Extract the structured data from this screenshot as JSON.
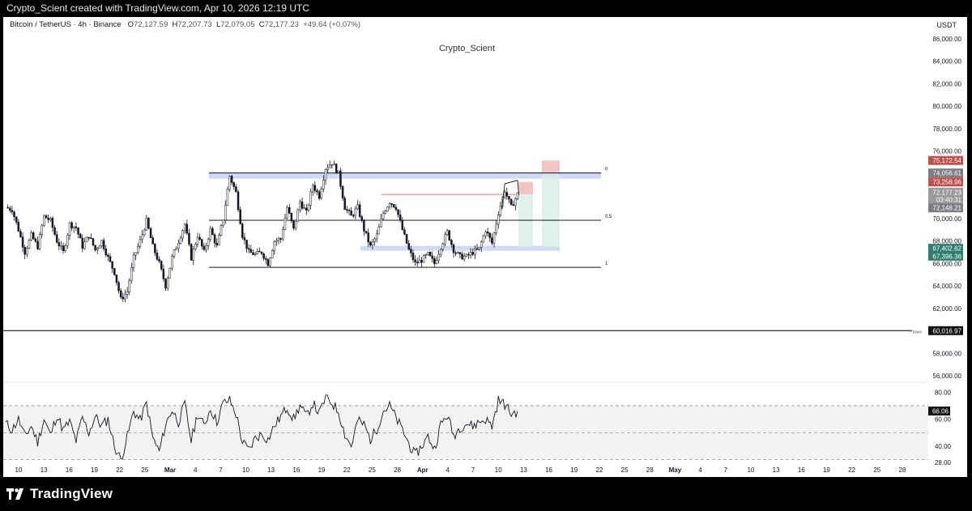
{
  "header": {
    "caption": "Crypto_Scient created with TradingView.com, Apr 10, 2026 12:19 UTC"
  },
  "legend": {
    "symbol": "Bitcoin / TetherUS · 4h · Binance",
    "o_label": "O",
    "o_value": "72,127.59",
    "h_label": "H",
    "h_value": "72,207.73",
    "l_label": "L",
    "l_value": "72,079.05",
    "c_label": "C",
    "c_value": "72,177.23",
    "change": "+49.64 (+0.07%)"
  },
  "watermark": "Crypto_Scient",
  "currency": "USDT",
  "footer": {
    "logo_text": "TradingView"
  },
  "colors": {
    "candle": "#131722",
    "range_band": "#c8d4f5",
    "red_line": "#e57373",
    "stop_zone": "#f2c4c4",
    "target_zone": "#d7ebe4",
    "rsi_band": "#f2f2f2"
  },
  "chart_data": [
    {
      "type": "candlestick",
      "symbol": "Bitcoin / TetherUS",
      "timeframe": "4h",
      "ylim": [
        57000,
        87000
      ],
      "y_ticks": [
        "86,000.00",
        "84,000.00",
        "82,000.00",
        "80,000.00",
        "78,000.00",
        "76,000.00",
        "74,000.00",
        "72,000.00",
        "70,000.00",
        "68,000.00",
        "66,000.00",
        "64,000.00",
        "62,000.00",
        "60,000.00",
        "58,000.00",
        "56,000.00"
      ],
      "x_ticks": [
        "10",
        "13",
        "16",
        "19",
        "22",
        "25",
        "Mar",
        "4",
        "7",
        "10",
        "13",
        "16",
        "19",
        "22",
        "25",
        "28",
        "Apr",
        "4",
        "7",
        "10",
        "13",
        "16",
        "19",
        "22",
        "25",
        "28",
        "May",
        "4",
        "7",
        "10",
        "13",
        "16",
        "19",
        "22",
        "25",
        "28"
      ],
      "close_path": [
        [
          0,
          71000
        ],
        [
          1,
          70800
        ],
        [
          2,
          69000
        ],
        [
          3,
          67000
        ],
        [
          4,
          68500
        ],
        [
          5,
          67500
        ],
        [
          6,
          70200
        ],
        [
          7,
          69800
        ],
        [
          8,
          68000
        ],
        [
          9,
          67000
        ],
        [
          10,
          69500
        ],
        [
          11,
          69200
        ],
        [
          12,
          67500
        ],
        [
          13,
          68500
        ],
        [
          14,
          67200
        ],
        [
          15,
          68000
        ],
        [
          16,
          66500
        ],
        [
          17,
          65200
        ],
        [
          18,
          62800
        ],
        [
          19,
          63500
        ],
        [
          20,
          66500
        ],
        [
          21,
          68000
        ],
        [
          22,
          69800
        ],
        [
          23,
          67500
        ],
        [
          24,
          66000
        ],
        [
          25,
          64000
        ],
        [
          26,
          66500
        ],
        [
          27,
          68000
        ],
        [
          28,
          69500
        ],
        [
          29,
          66500
        ],
        [
          30,
          68500
        ],
        [
          31,
          67000
        ],
        [
          32,
          69000
        ],
        [
          33,
          67500
        ],
        [
          34,
          70000
        ],
        [
          35,
          73800
        ],
        [
          36,
          72300
        ],
        [
          37,
          68500
        ],
        [
          38,
          67000
        ],
        [
          39,
          66800
        ],
        [
          40,
          67000
        ],
        [
          41,
          66000
        ],
        [
          42,
          68000
        ],
        [
          43,
          68200
        ],
        [
          44,
          71000
        ],
        [
          45,
          69000
        ],
        [
          46,
          71500
        ],
        [
          47,
          70500
        ],
        [
          48,
          73000
        ],
        [
          49,
          72000
        ],
        [
          50,
          74500
        ],
        [
          51,
          75000
        ],
        [
          52,
          74000
        ],
        [
          53,
          71000
        ],
        [
          54,
          70200
        ],
        [
          55,
          71000
        ],
        [
          56,
          69000
        ],
        [
          57,
          67500
        ],
        [
          58,
          68500
        ],
        [
          59,
          70500
        ],
        [
          60,
          71500
        ],
        [
          61,
          71000
        ],
        [
          62,
          69000
        ],
        [
          63,
          67200
        ],
        [
          64,
          66000
        ],
        [
          65,
          66300
        ],
        [
          66,
          66800
        ],
        [
          67,
          66000
        ],
        [
          68,
          67500
        ],
        [
          69,
          68800
        ],
        [
          70,
          67200
        ],
        [
          71,
          66600
        ],
        [
          72,
          66600
        ],
        [
          73,
          67000
        ],
        [
          74,
          67300
        ],
        [
          75,
          69000
        ],
        [
          76,
          67800
        ],
        [
          77,
          70500
        ],
        [
          78,
          72500
        ],
        [
          79,
          71000
        ],
        [
          80,
          72177
        ]
      ],
      "levels": [
        {
          "label": "0",
          "value": 74056.61
        },
        {
          "label": "0.5",
          "value": 69850
        },
        {
          "label": "1",
          "value": 65650
        }
      ],
      "horizontal_line": {
        "label": "lows",
        "value": 60016.97
      },
      "red_level": 72148,
      "price_labels": [
        {
          "value": "75,172.54",
          "y": 75172.54,
          "bg": "#c0504d"
        },
        {
          "value": "74,056.61",
          "y": 74056.61,
          "bg": "#7d7d85"
        },
        {
          "value": "73,258.96",
          "y": 73258.96,
          "bg": "#c0504d"
        },
        {
          "value": "72,177.23",
          "y": 72350,
          "bg": "#9a9a9a"
        },
        {
          "value": "03:40:31",
          "y": 71700,
          "bg": "#9a9a9a"
        },
        {
          "value": "72,148.21",
          "y": 70950,
          "bg": "#7d7d85"
        },
        {
          "value": "67,402.62",
          "y": 67350,
          "bg": "#2e7d6f"
        },
        {
          "value": "67,396.36",
          "y": 66650,
          "bg": "#2e7d6f"
        },
        {
          "value": "60,016.97",
          "y": 60016.97,
          "bg": "#111111"
        }
      ]
    },
    {
      "type": "line",
      "indicator": "RSI",
      "ylim": [
        25,
        85
      ],
      "y_ticks": [
        "80.00",
        "60.00",
        "40.00",
        "28.00"
      ],
      "bands": [
        70,
        50,
        30
      ],
      "current_value": "66.06",
      "values": [
        57,
        52,
        60,
        47,
        55,
        43,
        60,
        48,
        63,
        52,
        58,
        44,
        61,
        50,
        62,
        55,
        60,
        40,
        30,
        47,
        66,
        59,
        72,
        46,
        36,
        56,
        67,
        58,
        71,
        44,
        64,
        55,
        68,
        58,
        72,
        74,
        64,
        43,
        37,
        46,
        49,
        45,
        55,
        62,
        69,
        60,
        70,
        62,
        72,
        64,
        76,
        72,
        66,
        49,
        40,
        59,
        56,
        45,
        53,
        66,
        70,
        61,
        52,
        42,
        33,
        40,
        47,
        38,
        56,
        63,
        48,
        54,
        57,
        55,
        58,
        60,
        55,
        74,
        71,
        64,
        66
      ]
    }
  ]
}
